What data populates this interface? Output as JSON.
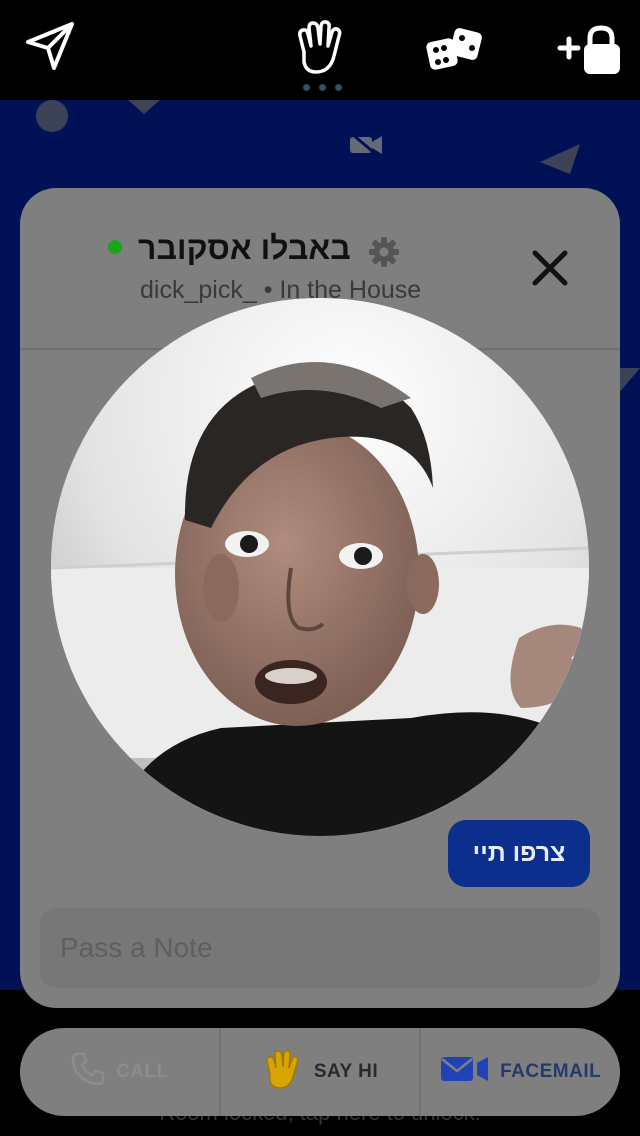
{
  "topbar": {
    "icons": [
      "send-icon",
      "wave-hand-icon",
      "dice-icon",
      "add-lock-icon"
    ],
    "active_index": 1
  },
  "profile": {
    "name": "באבלו אסקובר",
    "username": "dick_pick_",
    "status": "In the House",
    "online": true,
    "status_color": "#1aa51a"
  },
  "join_button": {
    "label": "צרפו תיי"
  },
  "note": {
    "placeholder": "Pass a Note",
    "value": ""
  },
  "actions": {
    "call": {
      "label": "CALL",
      "icon": "phone-icon",
      "enabled": false
    },
    "say_hi": {
      "label": "SAY HI",
      "icon": "wave-hand-icon"
    },
    "facemail": {
      "label": "FACEMAIL",
      "icon": "mail-video-icon"
    }
  },
  "room": {
    "background": "#001b84",
    "locked_text": "Room locked, tap here to unlock."
  }
}
